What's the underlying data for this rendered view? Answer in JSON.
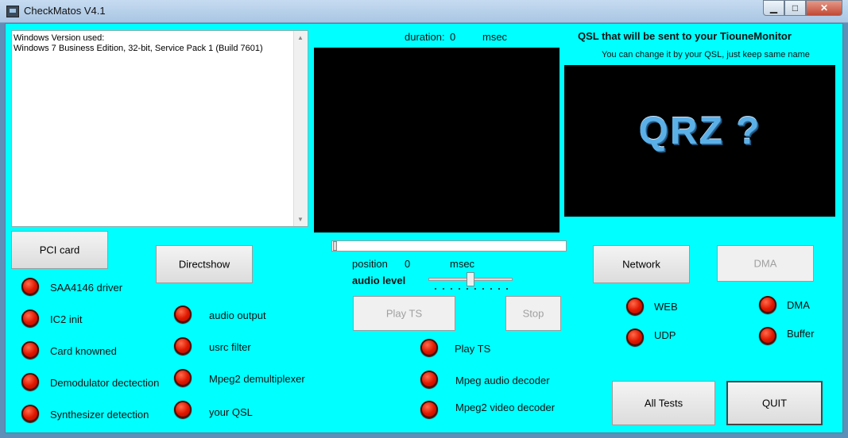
{
  "window": {
    "title": "CheckMatos V4.1",
    "min_glyph": "▁",
    "max_glyph": "□",
    "close_glyph": "✕"
  },
  "log": {
    "text": "Windows Version used:\nWindows 7 Business Edition, 32-bit, Service Pack 1 (Build 7601)"
  },
  "duration": {
    "label": "duration:",
    "value": "0",
    "unit": "msec"
  },
  "qsl": {
    "heading": "QSL that will be sent to your TiouneMonitor",
    "hint": "You can change it by your QSL, just keep same name",
    "image_text": "QRZ ?"
  },
  "position": {
    "label": "position",
    "value": "0",
    "unit": "msec",
    "fraction": 0
  },
  "audio": {
    "label": "audio level",
    "level": 0.5
  },
  "buttons": {
    "pci": "PCI card",
    "directshow": "Directshow",
    "play_ts": "Play TS",
    "stop": "Stop",
    "network": "Network",
    "dma": "DMA",
    "all_tests": "All Tests",
    "quit": "QUIT"
  },
  "indicators": {
    "pci": [
      "SAA4146 driver",
      "IC2 init",
      "Card knowned",
      "Demodulator dectection",
      "Synthesizer detection"
    ],
    "directshow": [
      "audio output",
      "usrc filter",
      "Mpeg2 demultiplexer",
      "your QSL"
    ],
    "play": [
      "Play TS",
      "Mpeg audio decoder",
      "Mpeg2 video decoder"
    ],
    "network": [
      "WEB",
      "UDP"
    ],
    "dma": [
      "DMA",
      "Buffer"
    ]
  },
  "colors": {
    "background": "#00ffff",
    "led_off": "#e01800"
  }
}
